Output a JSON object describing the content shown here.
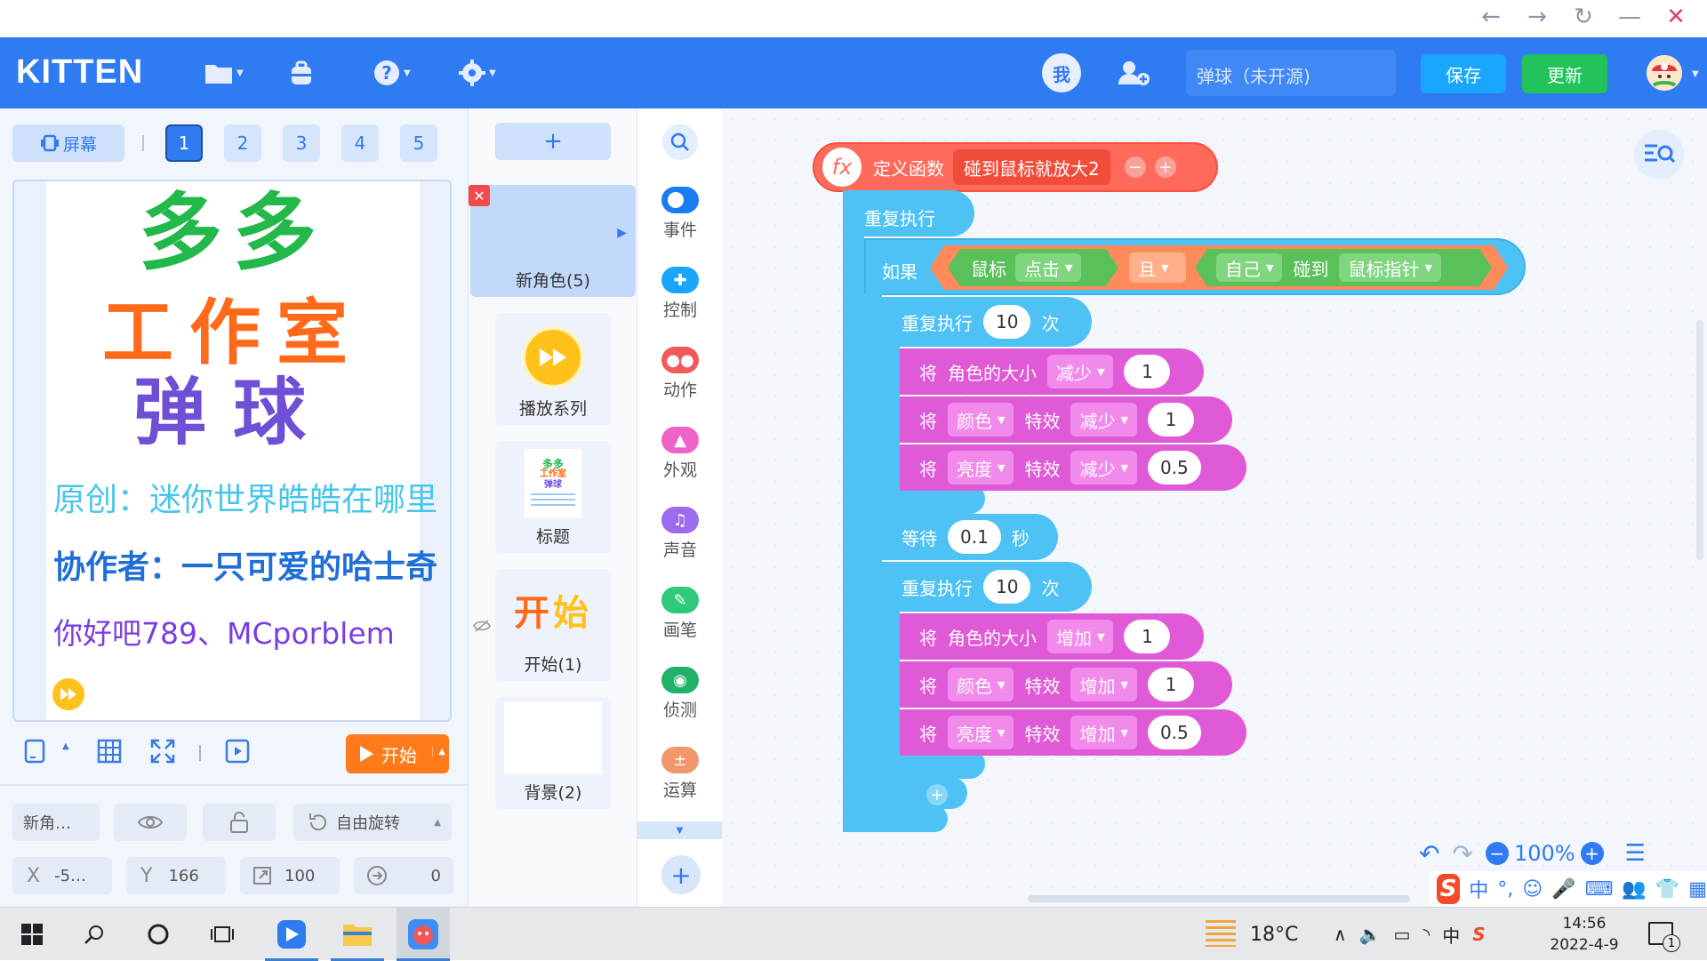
{
  "window": {
    "controls": [
      "←",
      "→",
      "↻",
      "—",
      "✕"
    ]
  },
  "app": {
    "logo": "KITTEN",
    "me_label": "我",
    "project_name": "弹球（未开源)",
    "save_label": "保存",
    "update_label": "更新"
  },
  "stage": {
    "screen_label": "屏幕",
    "separator": "I",
    "pages": [
      "1",
      "2",
      "3",
      "4",
      "5"
    ],
    "start_label": "开始",
    "title_lines": [
      "多多",
      "工作室",
      "弹球"
    ],
    "credit_lines": [
      "原创：迷你世界皓皓在哪里",
      "协作者：一只可爱的哈士奇",
      "你好吧789、MCporblem"
    ]
  },
  "props": {
    "name": "新角…",
    "rotation_label": "自由旋转",
    "x_label": "X",
    "x_value": "-5…",
    "y_label": "Y",
    "y_value": "166",
    "size_value": "100",
    "dir_value": "0"
  },
  "sprites": {
    "add_label": "+",
    "items": [
      {
        "name": "新角色(5)"
      },
      {
        "name": "播放系列"
      },
      {
        "name": "标题"
      },
      {
        "name": "开始(1)",
        "thumb1": "开",
        "thumb2": "始"
      },
      {
        "name": "背景(2)"
      }
    ]
  },
  "categories": [
    {
      "label": "事件",
      "color": "#1a7bf2"
    },
    {
      "label": "控制",
      "color": "#1aa5ff"
    },
    {
      "label": "动作",
      "color": "#f25a5a"
    },
    {
      "label": "外观",
      "color": "#f062c8"
    },
    {
      "label": "声音",
      "color": "#9b6cf0"
    },
    {
      "label": "画笔",
      "color": "#2ec97a"
    },
    {
      "label": "侦测",
      "color": "#22b06b"
    },
    {
      "label": "运算",
      "color": "#f2966c"
    }
  ],
  "code": {
    "def_func": "定义函数",
    "func_name": "碰到鼠标就放大2",
    "repeat_forever": "重复执行",
    "if": "如果",
    "mouse": "鼠标",
    "click": "点击",
    "and": "且",
    "self": "自己",
    "touch": "碰到",
    "mouse_pointer": "鼠标指针",
    "repeat": "重复执行",
    "times": "次",
    "n1": "10",
    "set": "将",
    "size_label": "角色的大小",
    "reduce": "减少",
    "increase": "增加",
    "color": "颜色",
    "brightness": "亮度",
    "effect": "特效",
    "v1": "1",
    "v05": "0.5",
    "wait": "等待",
    "wait_val": "0.1",
    "sec": "秒",
    "plus": "+"
  },
  "zoom": {
    "value": "100%"
  },
  "ime": {
    "lang": "中",
    "punct": "°,"
  },
  "taskbar": {
    "weather": "18°C",
    "time": "14:56",
    "date": "2022-4-9",
    "notify": "1",
    "ime_tray": "中"
  }
}
